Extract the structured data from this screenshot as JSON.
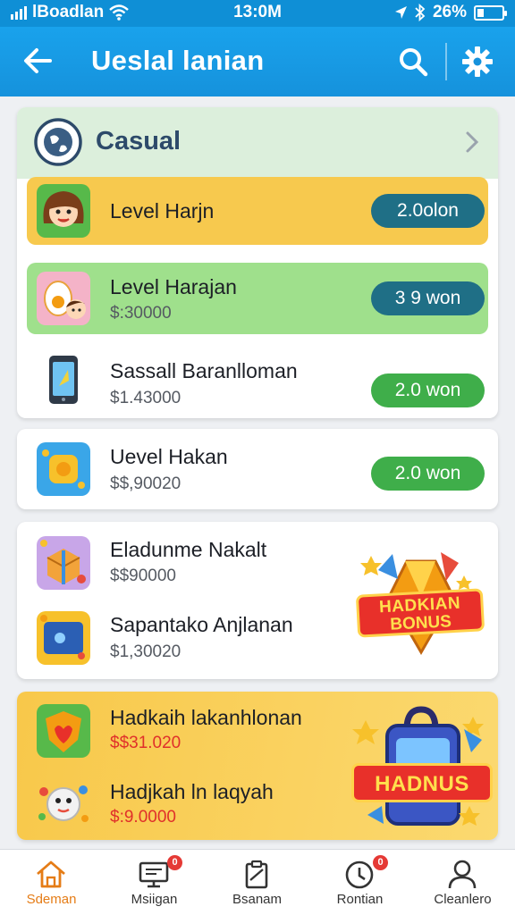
{
  "status_bar": {
    "carrier": "lBoadlan",
    "time": "13:0M",
    "battery": "26%"
  },
  "app_bar": {
    "title": "Ueslal lanian"
  },
  "category": {
    "title": "Casual"
  },
  "items": [
    {
      "name": "Level Harjn",
      "price": "",
      "button": "2.0olon"
    },
    {
      "name": "Level Harajan",
      "price": "$:30000",
      "button": "3 9 won"
    },
    {
      "name": "Sassall Baranlloman",
      "price": "$1.43000",
      "button": "2.0 won"
    },
    {
      "name": "Uevel Hakan",
      "price": "$$,90020",
      "button": "2.0 won"
    },
    {
      "name": "Eladunme Nakalt",
      "price": "$$90000"
    },
    {
      "name": "Sapantako Anjlanan",
      "price": "$1,30020"
    },
    {
      "name": "Hadkaih lakanhlonan",
      "price": "$$31.020"
    },
    {
      "name": "Hadjkah ln laqyah",
      "price": "$:9.0000"
    }
  ],
  "promos": [
    {
      "line1": "HADKIAN",
      "line2": "BONUS"
    },
    {
      "line1": "HADNUS"
    }
  ],
  "bottom_nav": [
    {
      "label": "Sdeman",
      "icon": "home-icon",
      "badge": ""
    },
    {
      "label": "Msiigan",
      "icon": "monitor-icon",
      "badge": "0"
    },
    {
      "label": "Bsanam",
      "icon": "clipboard-icon",
      "badge": ""
    },
    {
      "label": "Rontian",
      "icon": "clock-icon",
      "badge": "0"
    },
    {
      "label": "Cleanlero",
      "icon": "user-icon",
      "badge": ""
    }
  ],
  "colors": {
    "app_bar": "#1692dc",
    "row_yellow": "#f7c94e",
    "row_green": "#9fe08c",
    "button_teal": "#1f6f86",
    "button_green": "#3fae4a",
    "nav_active": "#e57c16",
    "badge": "#e53935"
  }
}
